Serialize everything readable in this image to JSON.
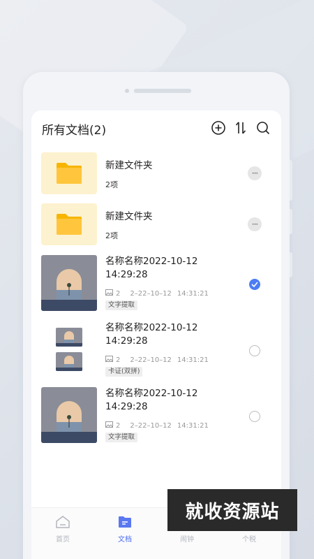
{
  "header": {
    "title": "所有文档(2)"
  },
  "items": [
    {
      "type": "folder",
      "name": "新建文件夹",
      "count": "2项"
    },
    {
      "type": "folder",
      "name": "新建文件夹",
      "count": "2项"
    },
    {
      "type": "doc",
      "name_line1": "名称名称2022-10-12",
      "name_line2": "14:29:28",
      "pages": "2",
      "date": "2–22–10–12",
      "time": "14:31:21",
      "tag": "文字提取",
      "selected": true
    },
    {
      "type": "doc",
      "name_line1": "名称名称2022-10-12",
      "name_line2": "14:29:28",
      "pages": "2",
      "date": "2–22–10–12",
      "time": "14:31:21",
      "tag": "卡证(双拼)",
      "selected": false
    },
    {
      "type": "doc",
      "name_line1": "名称名称2022-10-12",
      "name_line2": "14:29:28",
      "pages": "2",
      "date": "2–22–10–12",
      "time": "14:31:21",
      "tag": "文字提取",
      "selected": false
    }
  ],
  "tabbar": {
    "tabs": [
      {
        "label": "首页",
        "icon": "home-icon",
        "active": false
      },
      {
        "label": "文档",
        "icon": "document-icon",
        "active": true
      },
      {
        "label": "闹钟",
        "icon": "alarm-icon",
        "active": false
      },
      {
        "label": "个税",
        "icon": "tax-icon",
        "active": false
      }
    ]
  },
  "watermark": "就收资源站",
  "colors": {
    "accent": "#4d7cf4",
    "folder_bg": "#fdf2cf",
    "folder": "#ffc53d"
  }
}
